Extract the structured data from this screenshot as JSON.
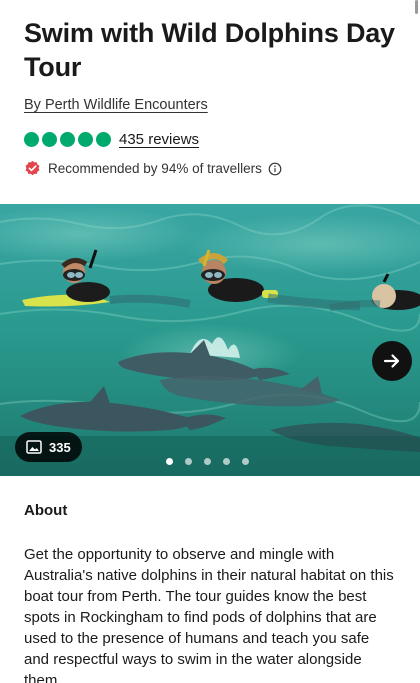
{
  "listing": {
    "title": "Swim with Wild Dolphins Day Tour",
    "operator": "By Perth Wildlife Encounters",
    "rating_bubbles": 5,
    "reviews_label": "435 reviews",
    "recommendation": "Recommended by 94% of travellers",
    "accent_color": "#00aa6c",
    "badge_color": "#e0464b"
  },
  "gallery": {
    "photo_count": "335",
    "total_dots": 5,
    "active_dot": 1,
    "next_icon": "arrow-right-icon",
    "count_icon": "image-icon"
  },
  "about": {
    "heading": "About",
    "text": "Get the opportunity to observe and mingle with Australia's native dolphins in their natural habitat on this boat tour from Perth. The tour guides know the best spots in Rockingham to find pods of dolphins that are used to the presence of humans and teach you safe and respectful ways to swim in the water alongside them."
  }
}
